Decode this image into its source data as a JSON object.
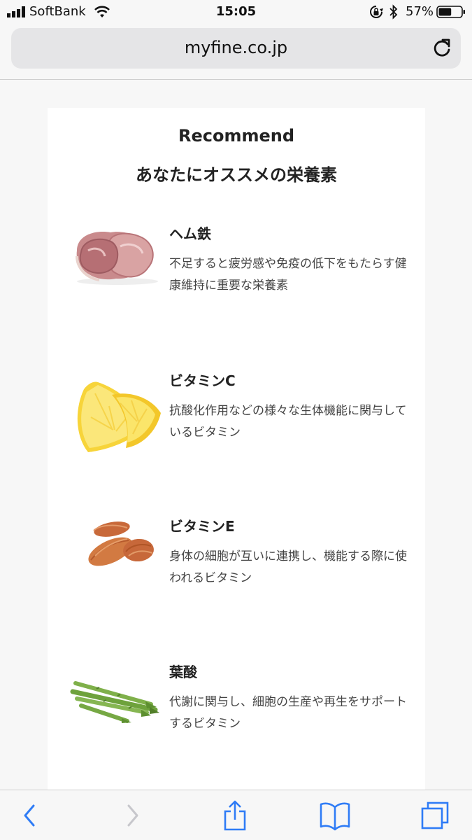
{
  "status_bar": {
    "carrier": "SoftBank",
    "time": "15:05",
    "battery_percent_label": "57%",
    "battery_level": 0.57,
    "icons": [
      "signal-icon",
      "wifi-icon",
      "orientation-lock-icon",
      "bluetooth-icon",
      "battery-icon"
    ]
  },
  "address_bar": {
    "url": "myfine.co.jp",
    "reload_icon": "reload-icon"
  },
  "content": {
    "heading_en": "Recommend",
    "heading_ja": "あなたにオススメの栄養素",
    "items": [
      {
        "title": "ヘム鉄",
        "desc": "不足すると疲労感や免疫の低下をもたらす健康維持に重要な栄養素",
        "image": "meat-image"
      },
      {
        "title": "ビタミンC",
        "desc": "抗酸化作用などの様々な生体機能に関与しているビタミン",
        "image": "lemon-image"
      },
      {
        "title": "ビタミンE",
        "desc": "身体の細胞が互いに連携し、機能する際に使われるビタミン",
        "image": "almond-image"
      },
      {
        "title": "葉酸",
        "desc": "代謝に関与し、細胞の生産や再生をサポートするビタミン",
        "image": "asparagus-image"
      }
    ]
  },
  "toolbar": {
    "accent_color": "#2f7cf6",
    "disabled_color": "#c7c7cc",
    "buttons": [
      "back-icon",
      "forward-icon",
      "share-icon",
      "bookmarks-icon",
      "tabs-icon"
    ]
  }
}
